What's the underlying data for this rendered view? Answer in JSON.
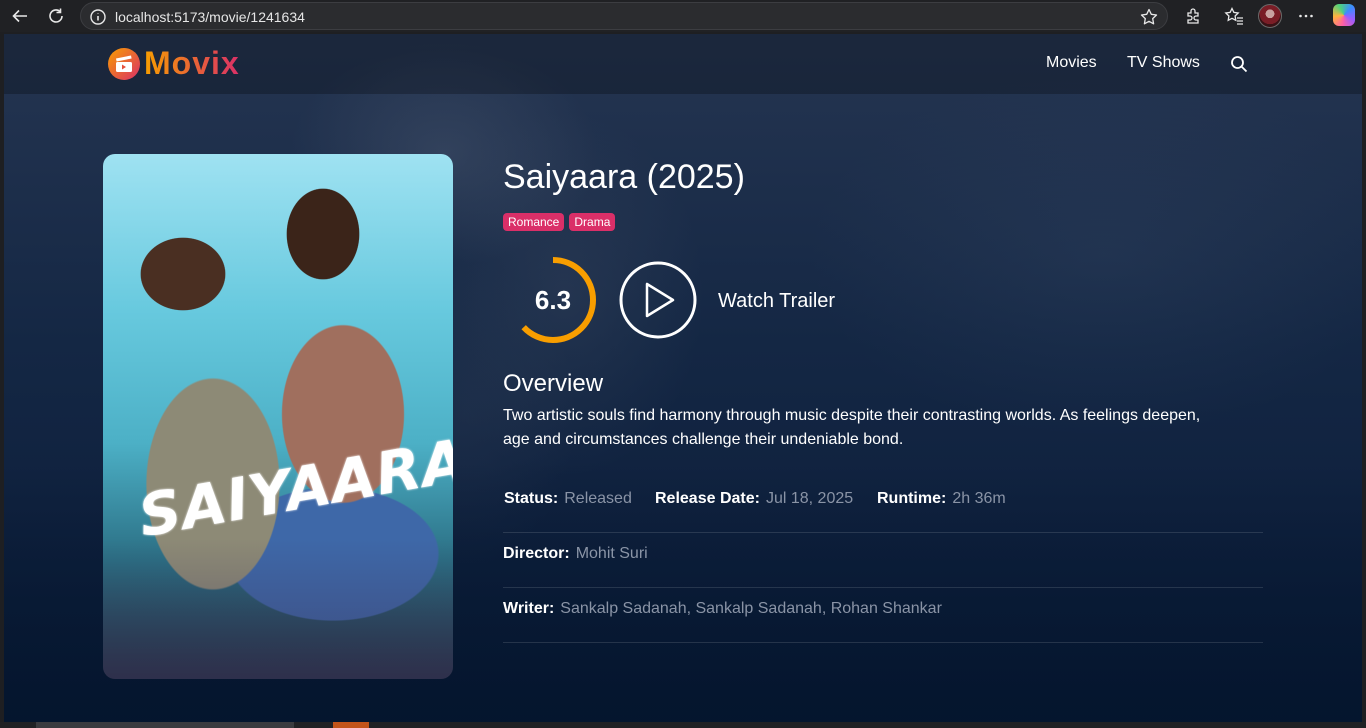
{
  "browser": {
    "url": "localhost:5173/movie/1241634"
  },
  "site": {
    "logo_text": "Movix",
    "nav": [
      {
        "label": "Movies"
      },
      {
        "label": "TV Shows"
      }
    ],
    "colors": {
      "accent_orange": "#f89e00",
      "accent_pink": "#da2f68",
      "background": "#04152d"
    }
  },
  "movie": {
    "poster_title": "SAIYAARA",
    "title": "Saiyaara (2025)",
    "genres": [
      "Romance",
      "Drama"
    ],
    "rating": "6.3",
    "rating_fraction": 0.63,
    "watch_trailer_label": "Watch Trailer",
    "overview_heading": "Overview",
    "overview_text": "Two artistic souls find harmony through music despite their contrasting worlds. As feelings deepen, age and circumstances challenge their undeniable bond.",
    "info": {
      "status_label": "Status:",
      "status_value": "Released",
      "release_label": "Release Date:",
      "release_value": "Jul 18, 2025",
      "runtime_label": "Runtime:",
      "runtime_value": "2h 36m",
      "director_label": "Director:",
      "director_value": "Mohit Suri",
      "writer_label": "Writer:",
      "writer_value": "Sankalp Sadanah, Sankalp Sadanah, Rohan Shankar"
    }
  },
  "icons": [
    "back-icon",
    "reload-icon",
    "info-icon",
    "star-icon",
    "extensions-icon",
    "favorites-icon",
    "more-icon",
    "search-icon",
    "play-icon",
    "clapper-icon"
  ]
}
